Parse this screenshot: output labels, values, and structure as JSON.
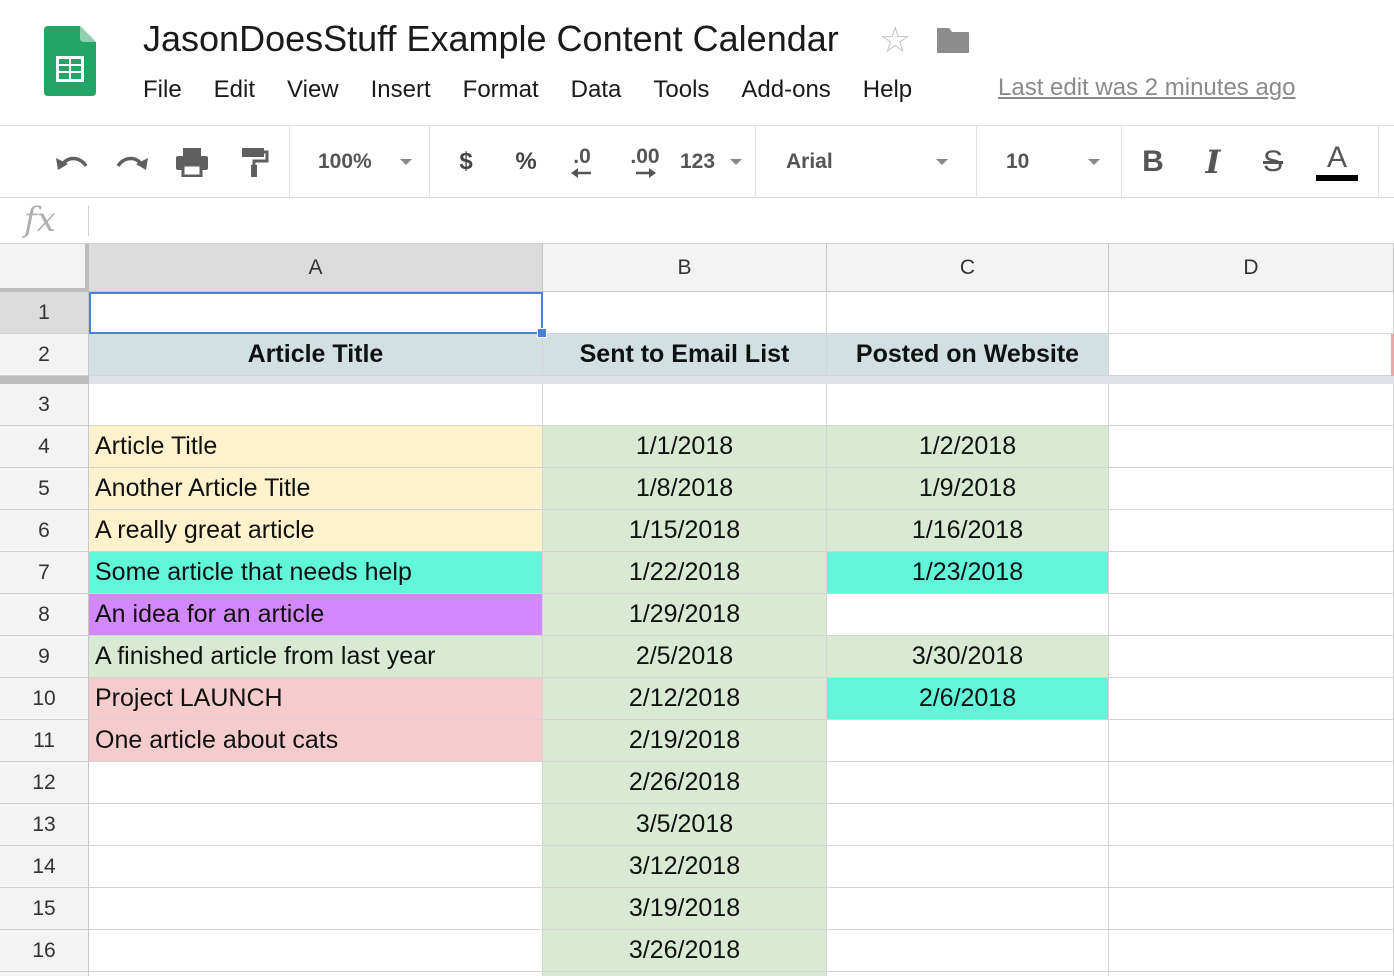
{
  "app": {
    "title": "JasonDoesStuff Example Content Calendar",
    "last_edit": "Last edit was 2 minutes ago"
  },
  "menu": [
    "File",
    "Edit",
    "View",
    "Insert",
    "Format",
    "Data",
    "Tools",
    "Add-ons",
    "Help"
  ],
  "toolbar": {
    "zoom": "100%",
    "currency": "$",
    "percent": "%",
    "decrease_decimal": ".0",
    "increase_decimal": ".00",
    "more_formats": "123",
    "font": "Arial",
    "font_size": "10",
    "bold": "B",
    "italic": "I",
    "strike": "S",
    "text_color": "A"
  },
  "formula_bar": {
    "label": "fx",
    "value": ""
  },
  "colors": {
    "header_fill": "#d0e0e3",
    "yellow": "#fff2cc",
    "green": "#d9ead3",
    "cyan": "#61f5da",
    "purple": "#d387fc",
    "pink": "#f4cccc",
    "selection": "#4a7fe0"
  },
  "grid": {
    "columns": [
      "A",
      "B",
      "C",
      "D"
    ],
    "rows": [
      {
        "n": "1",
        "a": "",
        "b": "",
        "c": "",
        "a_fill": "",
        "b_fill": "",
        "c_fill": ""
      },
      {
        "n": "2",
        "a": "Article Title",
        "b": "Sent to Email List",
        "c": "Posted on Website",
        "a_fill": "header",
        "b_fill": "header",
        "c_fill": "header"
      },
      {
        "n": "3",
        "a": "",
        "b": "",
        "c": "",
        "a_fill": "",
        "b_fill": "",
        "c_fill": ""
      },
      {
        "n": "4",
        "a": "Article Title",
        "b": "1/1/2018",
        "c": "1/2/2018",
        "a_fill": "yellow",
        "b_fill": "green",
        "c_fill": "green"
      },
      {
        "n": "5",
        "a": "Another Article Title",
        "b": "1/8/2018",
        "c": "1/9/2018",
        "a_fill": "yellow",
        "b_fill": "green",
        "c_fill": "green"
      },
      {
        "n": "6",
        "a": "A really great article",
        "b": "1/15/2018",
        "c": "1/16/2018",
        "a_fill": "yellow",
        "b_fill": "green",
        "c_fill": "green"
      },
      {
        "n": "7",
        "a": "Some article that needs help",
        "b": "1/22/2018",
        "c": "1/23/2018",
        "a_fill": "cyan",
        "b_fill": "green",
        "c_fill": "cyan"
      },
      {
        "n": "8",
        "a": "An idea for an article",
        "b": "1/29/2018",
        "c": "",
        "a_fill": "purple",
        "b_fill": "green",
        "c_fill": ""
      },
      {
        "n": "9",
        "a": "A finished article from last year",
        "b": "2/5/2018",
        "c": "3/30/2018",
        "a_fill": "green",
        "b_fill": "green",
        "c_fill": "green"
      },
      {
        "n": "10",
        "a": "Project LAUNCH",
        "b": "2/12/2018",
        "c": "2/6/2018",
        "a_fill": "pink",
        "b_fill": "green",
        "c_fill": "cyan"
      },
      {
        "n": "11",
        "a": "One article about cats",
        "b": "2/19/2018",
        "c": "",
        "a_fill": "pink",
        "b_fill": "green",
        "c_fill": ""
      },
      {
        "n": "12",
        "a": "",
        "b": "2/26/2018",
        "c": "",
        "a_fill": "",
        "b_fill": "green",
        "c_fill": ""
      },
      {
        "n": "13",
        "a": "",
        "b": "3/5/2018",
        "c": "",
        "a_fill": "",
        "b_fill": "green",
        "c_fill": ""
      },
      {
        "n": "14",
        "a": "",
        "b": "3/12/2018",
        "c": "",
        "a_fill": "",
        "b_fill": "green",
        "c_fill": ""
      },
      {
        "n": "15",
        "a": "",
        "b": "3/19/2018",
        "c": "",
        "a_fill": "",
        "b_fill": "green",
        "c_fill": ""
      },
      {
        "n": "16",
        "a": "",
        "b": "3/26/2018",
        "c": "",
        "a_fill": "",
        "b_fill": "green",
        "c_fill": ""
      },
      {
        "n": "",
        "a": "",
        "b": "",
        "c": "",
        "a_fill": "",
        "b_fill": "green",
        "c_fill": ""
      }
    ]
  }
}
